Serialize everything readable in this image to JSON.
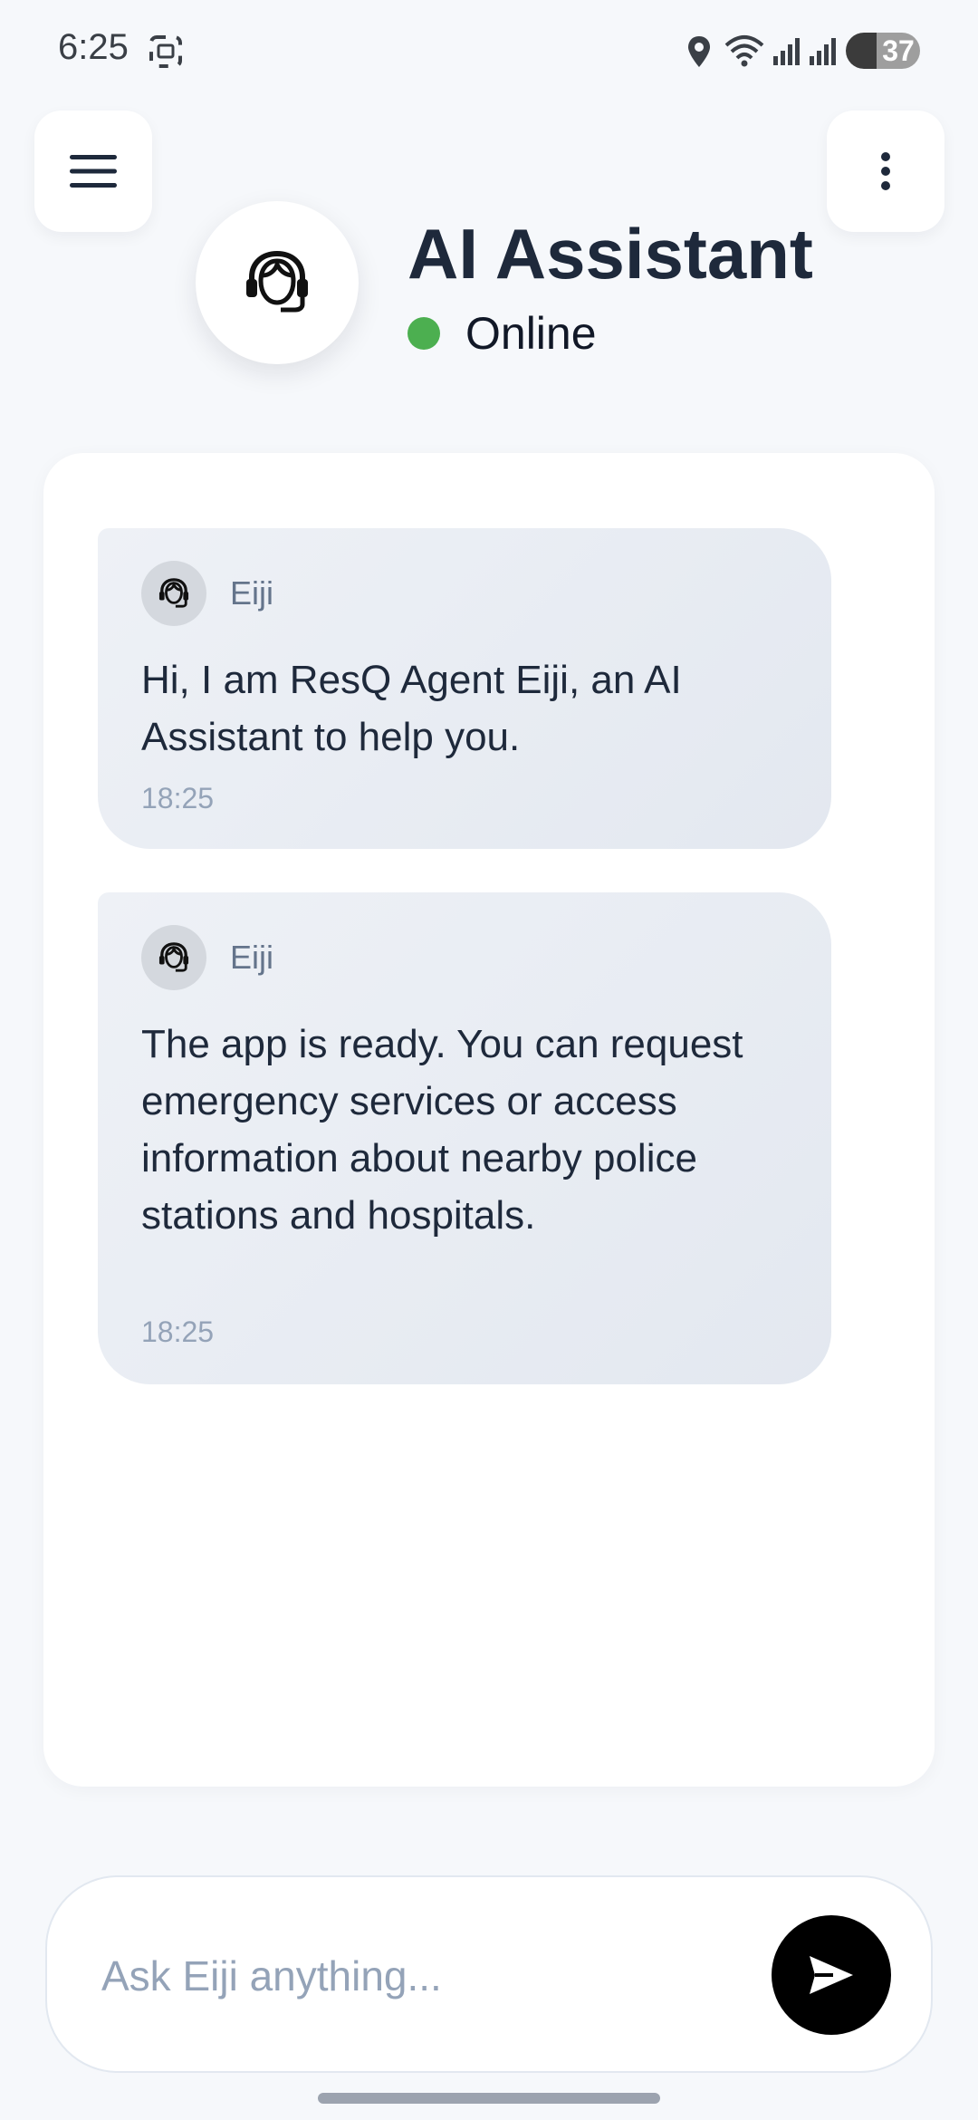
{
  "status_bar": {
    "time": "6:25",
    "battery": "37",
    "icons": [
      "screenshot-icon",
      "location-icon",
      "wifi-icon",
      "signal-icon",
      "signal-icon",
      "battery-icon"
    ]
  },
  "header": {
    "menu_icon": "hamburger-menu-icon",
    "more_icon": "more-vertical-icon",
    "avatar_icon": "headset-agent-icon",
    "title": "AI Assistant",
    "status": "Online",
    "status_color": "#4caf50"
  },
  "messages": [
    {
      "sender": "Eiji",
      "text": "Hi, I am ResQ Agent Eiji, an AI Assistant to help you.",
      "time": "18:25"
    },
    {
      "sender": "Eiji",
      "text": "The app is ready. You can request emergency services or access information about nearby police stations and hospitals.",
      "time": "18:25"
    }
  ],
  "composer": {
    "placeholder": "Ask Eiji anything...",
    "value": "",
    "send_icon": "send-icon"
  },
  "colors": {
    "background": "#f6f8fb",
    "card": "#ffffff",
    "bubble": "#e8ecf2",
    "title": "#1e293b",
    "send_button": "#000000"
  }
}
